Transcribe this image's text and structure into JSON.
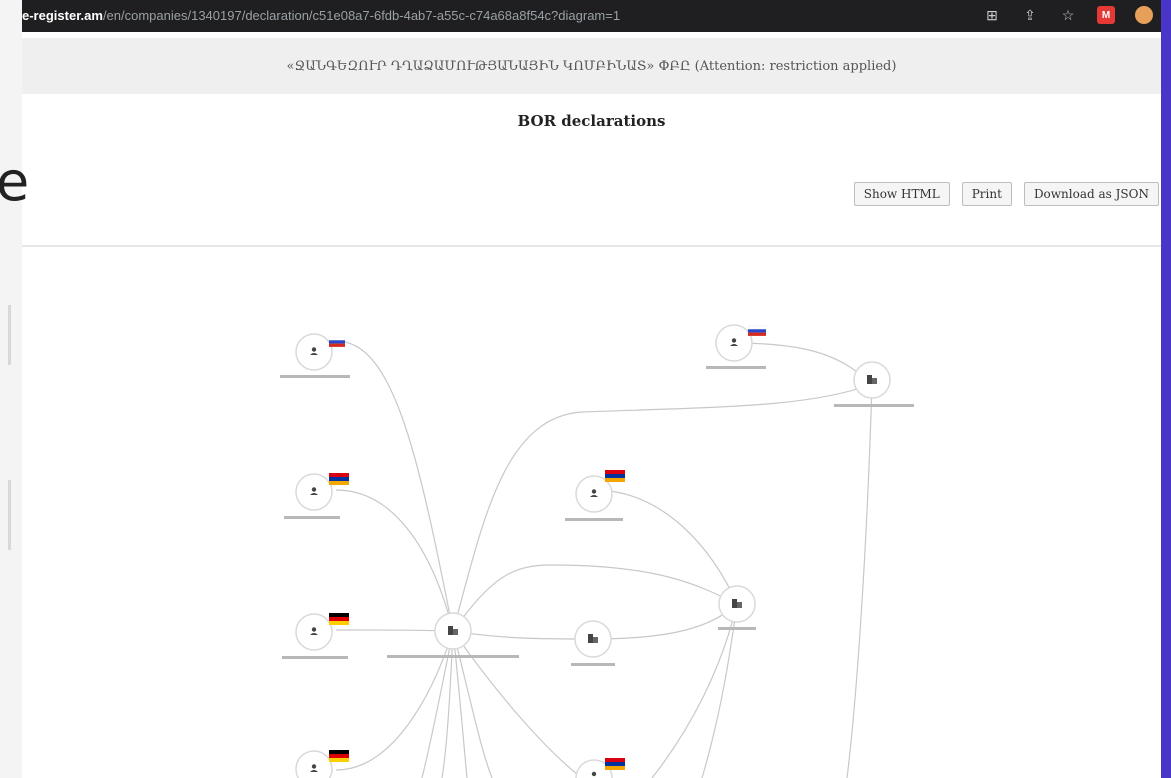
{
  "browser": {
    "url_domain": "e-register.am",
    "url_path": "/en/companies/1340197/declaration/c51e08a7-6fdb-4ab7-a55c-c74a68a8f54c?diagram=1"
  },
  "page": {
    "company_title": "«ՋԱՆԳԵԶՈՒՐ ԴՂԱՁԱՄՈՒԹՅԱՆԱՅԻՆ ԿՈՄԲԻՆԱՏ» ՓԲԸ (Attention: restriction applied)",
    "heading": "BOR declarations"
  },
  "buttons": {
    "show_html": "Show HTML",
    "print": "Print",
    "download_json": "Download as JSON"
  },
  "left_cut_glyph": "e",
  "icons": {
    "person": "person-icon",
    "company": "building-icon"
  }
}
